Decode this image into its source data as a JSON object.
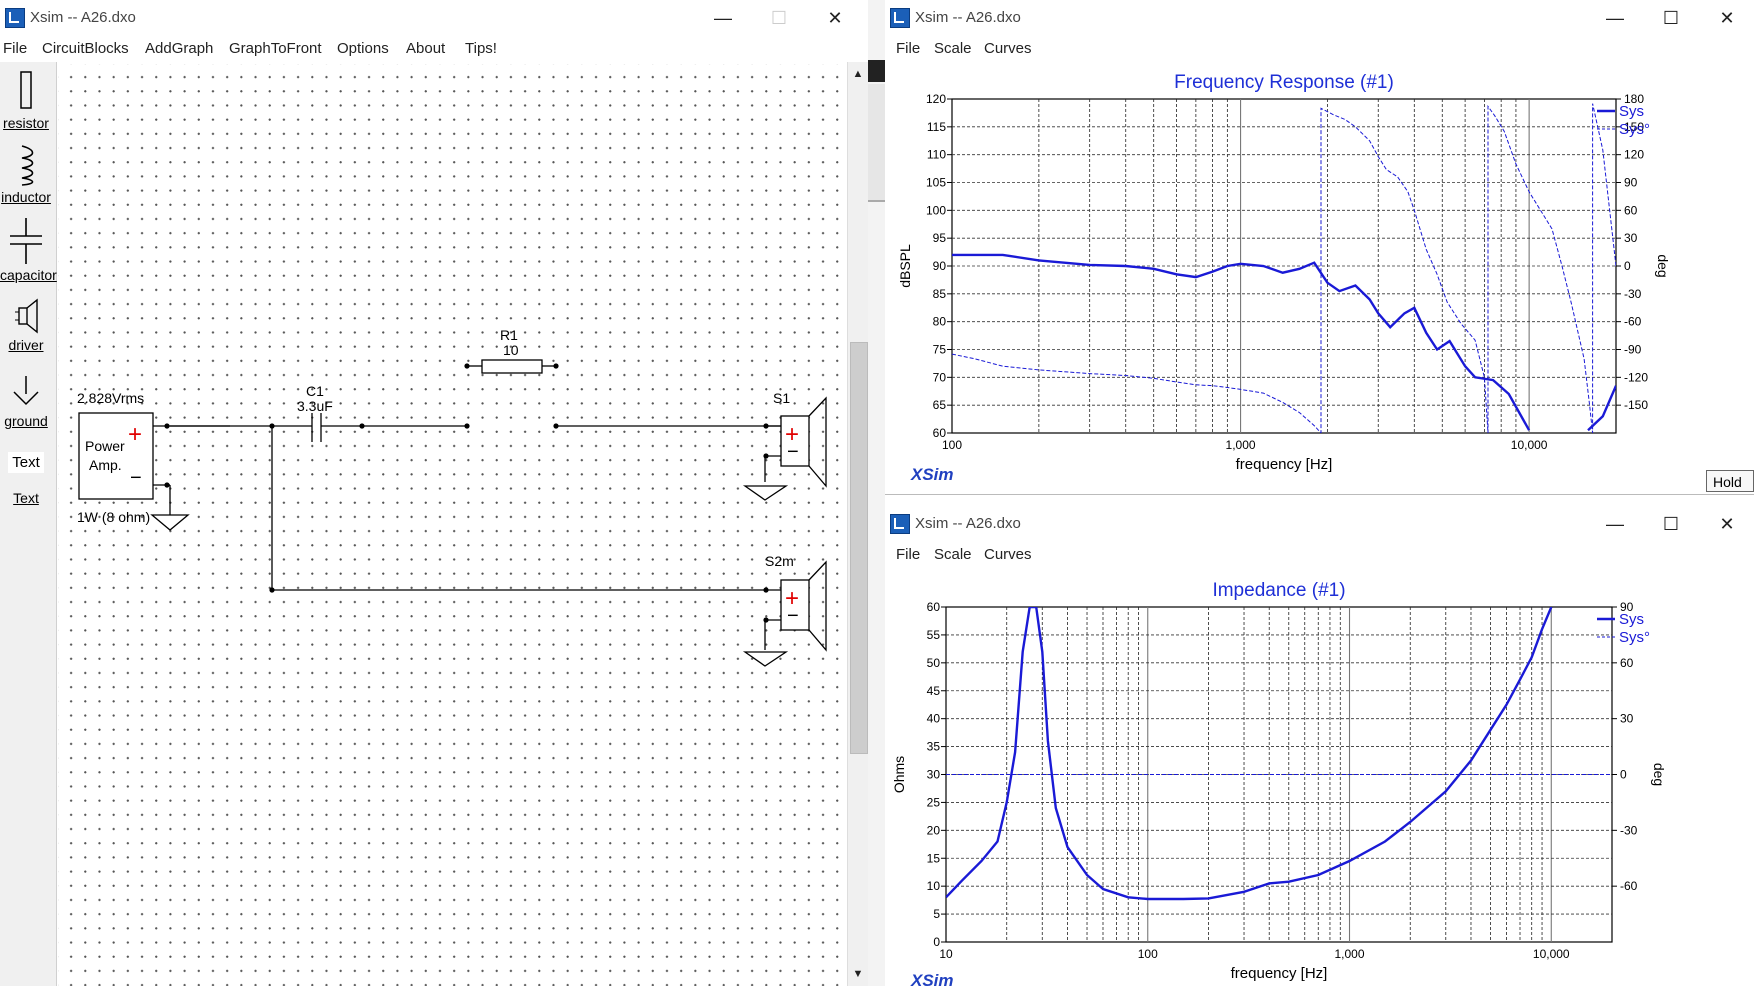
{
  "main_window": {
    "title": "Xsim -- A26.dxo",
    "menu": [
      "File",
      "CircuitBlocks",
      "AddGraph",
      "GraphToFront",
      "Options",
      "About",
      "Tips!"
    ],
    "toolbar": [
      {
        "label": "resistor",
        "icon": "resistor-icon"
      },
      {
        "label": "inductor",
        "icon": "inductor-icon"
      },
      {
        "label": "capacitor",
        "icon": "capacitor-icon"
      },
      {
        "label": "driver",
        "icon": "driver-icon"
      },
      {
        "label": "ground",
        "icon": "ground-icon"
      },
      {
        "label": "Text",
        "icon": "text-icon"
      },
      {
        "label": "Text",
        "icon": "text-link"
      }
    ],
    "schematic": {
      "source_level": "2.828Vrms",
      "amp_line1": "Power",
      "amp_line2": "Amp.",
      "amp_rating": "1W (8 ohm)",
      "c1_name": "C1",
      "c1_value": "3.3uF",
      "r1_name": "R1",
      "r1_value": "10",
      "s1_name": "S1",
      "s2_name": "S2m",
      "plus": "+",
      "minus": "−"
    }
  },
  "graph_windows": [
    {
      "title": "Xsim -- A26.dxo",
      "menu": [
        "File",
        "Scale",
        "Curves"
      ],
      "chart_data": {
        "type": "line",
        "title": "Frequency Response (#1)",
        "xlabel": "frequency [Hz]",
        "ylabel": "dBSPL",
        "y2label": "deg",
        "x_scale": "log",
        "xlim": [
          100,
          20000
        ],
        "ylim": [
          60,
          120
        ],
        "y2lim": [
          -180,
          180
        ],
        "x_ticks": [
          "100",
          "1,000",
          "10,000"
        ],
        "y_ticks": [
          "60",
          "65",
          "70",
          "75",
          "80",
          "85",
          "90",
          "95",
          "100",
          "105",
          "110",
          "115",
          "120"
        ],
        "y2_ticks": [
          "-150",
          "-120",
          "-90",
          "-60",
          "-30",
          "0",
          "30",
          "60",
          "90",
          "120",
          "150",
          "180"
        ],
        "legend_position": "top-right",
        "brand": "XSim",
        "series": [
          {
            "name": "Sys",
            "axis": "left",
            "style": "solid-thick",
            "points": [
              [
                100,
                92
              ],
              [
                150,
                92
              ],
              [
                200,
                91
              ],
              [
                300,
                90.2
              ],
              [
                400,
                90
              ],
              [
                500,
                89.5
              ],
              [
                600,
                88.5
              ],
              [
                700,
                88
              ],
              [
                800,
                89
              ],
              [
                900,
                90
              ],
              [
                1000,
                90.4
              ],
              [
                1200,
                90
              ],
              [
                1400,
                88.8
              ],
              [
                1600,
                89.5
              ],
              [
                1800,
                90.6
              ],
              [
                2000,
                87
              ],
              [
                2200,
                85.5
              ],
              [
                2500,
                86.5
              ],
              [
                2800,
                84
              ],
              [
                3000,
                81.5
              ],
              [
                3300,
                79
              ],
              [
                3700,
                81.5
              ],
              [
                4000,
                82.5
              ],
              [
                4400,
                78
              ],
              [
                4800,
                75
              ],
              [
                5300,
                76.5
              ],
              [
                6000,
                72
              ],
              [
                6500,
                70
              ],
              [
                7500,
                69.5
              ],
              [
                8500,
                67
              ],
              [
                10000,
                60.5
              ]
            ]
          },
          {
            "name": "Sys",
            "axis": "left",
            "style": "solid-thick",
            "points": [
              [
                16000,
                60.5
              ],
              [
                18000,
                63
              ],
              [
                20000,
                68.5
              ]
            ]
          },
          {
            "name": "Sys°",
            "axis": "right",
            "style": "dashed",
            "points": [
              [
                100,
                -95
              ],
              [
                120,
                -100
              ],
              [
                150,
                -108
              ],
              [
                200,
                -112
              ],
              [
                300,
                -116
              ],
              [
                400,
                -118
              ],
              [
                500,
                -121
              ],
              [
                600,
                -125
              ],
              [
                700,
                -128
              ],
              [
                800,
                -129
              ],
              [
                900,
                -131
              ],
              [
                1000,
                -133
              ],
              [
                1200,
                -137
              ],
              [
                1400,
                -147
              ],
              [
                1600,
                -158
              ],
              [
                1800,
                -172
              ],
              [
                1900,
                -180
              ],
              [
                1900,
                170
              ],
              [
                2100,
                163
              ],
              [
                2300,
                158
              ],
              [
                2500,
                150
              ],
              [
                2800,
                135
              ],
              [
                3000,
                118
              ],
              [
                3200,
                104
              ],
              [
                3500,
                96
              ],
              [
                3800,
                80
              ],
              [
                4000,
                60
              ],
              [
                4400,
                18
              ],
              [
                4800,
                -9
              ],
              [
                5200,
                -39
              ],
              [
                5800,
                -62
              ],
              [
                6500,
                -80
              ],
              [
                7000,
                -120
              ],
              [
                7200,
                -180
              ],
              [
                7200,
                172
              ],
              [
                7600,
                162
              ],
              [
                8200,
                145
              ],
              [
                9000,
                110
              ],
              [
                10000,
                80
              ],
              [
                12000,
                40
              ],
              [
                13000,
                0
              ],
              [
                14000,
                -40
              ],
              [
                15500,
                -100
              ],
              [
                16200,
                -150
              ],
              [
                16600,
                -180
              ],
              [
                16600,
                175
              ],
              [
                18000,
                125
              ],
              [
                20000,
                0
              ]
            ]
          }
        ]
      }
    },
    {
      "title": "Xsim -- A26.dxo",
      "menu": [
        "File",
        "Scale",
        "Curves"
      ],
      "chart_data": {
        "type": "line",
        "title": "Impedance (#1)",
        "xlabel": "frequency [Hz]",
        "ylabel": "Ohms",
        "y2label": "deg",
        "x_scale": "log",
        "xlim": [
          10,
          20000
        ],
        "ylim": [
          0,
          60
        ],
        "y2lim": [
          -90,
          90
        ],
        "x_ticks": [
          "10",
          "100",
          "1,000",
          "10,000"
        ],
        "y_ticks": [
          "0",
          "5",
          "10",
          "15",
          "20",
          "25",
          "30",
          "35",
          "40",
          "45",
          "50",
          "55",
          "60"
        ],
        "y2_ticks": [
          "-60",
          "-30",
          "0",
          "30",
          "60",
          "90"
        ],
        "legend_position": "top-right",
        "brand": "XSim",
        "series": [
          {
            "name": "Sys",
            "axis": "left",
            "style": "solid-thick",
            "points": [
              [
                10,
                8
              ],
              [
                12,
                11
              ],
              [
                15,
                14.5
              ],
              [
                18,
                18
              ],
              [
                20,
                25
              ],
              [
                22,
                34
              ],
              [
                24,
                52
              ],
              [
                26,
                60
              ],
              [
                28,
                60
              ],
              [
                30,
                52
              ],
              [
                32,
                36
              ],
              [
                35,
                24
              ],
              [
                40,
                17
              ],
              [
                50,
                12
              ],
              [
                60,
                9.5
              ],
              [
                80,
                8
              ],
              [
                100,
                7.7
              ],
              [
                150,
                7.7
              ],
              [
                200,
                7.8
              ],
              [
                300,
                9
              ],
              [
                400,
                10.5
              ],
              [
                500,
                10.8
              ],
              [
                700,
                12
              ],
              [
                1000,
                14.5
              ],
              [
                1500,
                18
              ],
              [
                2000,
                21.5
              ],
              [
                3000,
                27
              ],
              [
                4000,
                32.5
              ],
              [
                5000,
                38
              ],
              [
                6000,
                42.5
              ],
              [
                7000,
                47
              ],
              [
                8000,
                51
              ],
              [
                9000,
                56
              ],
              [
                10000,
                60
              ]
            ]
          },
          {
            "name": "Sys°",
            "axis": "right",
            "style": "dashed",
            "points": [
              [
                10,
                0
              ],
              [
                20000,
                0
              ]
            ]
          }
        ]
      }
    }
  ],
  "hold_button": "Hold"
}
